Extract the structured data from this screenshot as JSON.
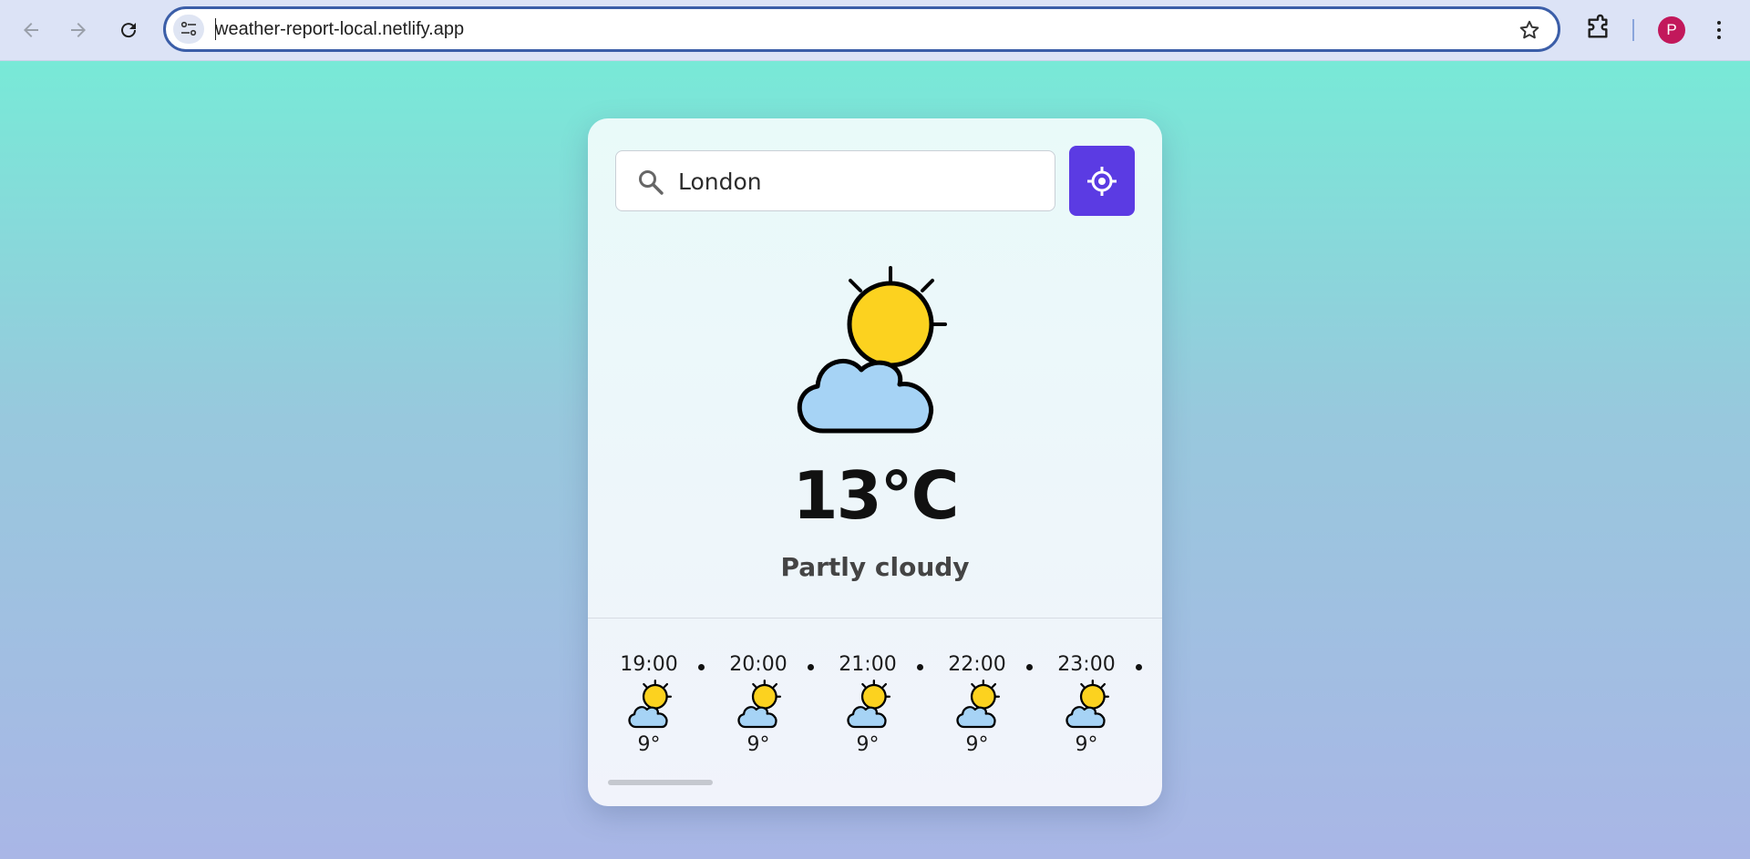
{
  "browser": {
    "url": "weather-report-local.netlify.app",
    "profile_initial": "P",
    "icons": {
      "back": "arrow-left-icon",
      "forward": "arrow-right-icon",
      "reload": "reload-icon",
      "site_info": "tune-icon",
      "bookmark": "star-icon",
      "extensions": "puzzle-icon",
      "menu": "three-dots-vertical-icon"
    },
    "profile_color": "#c2185b"
  },
  "search": {
    "value": "London",
    "icon": "search-icon"
  },
  "locate_button": {
    "icon": "crosshair-location-icon",
    "color": "#5b3be3"
  },
  "current": {
    "icon": "partly-cloudy-icon",
    "temperature": "13°C",
    "condition": "Partly cloudy"
  },
  "hourly": [
    {
      "time": "19:00",
      "icon": "partly-cloudy-icon",
      "temp": "9°"
    },
    {
      "time": "20:00",
      "icon": "partly-cloudy-icon",
      "temp": "9°"
    },
    {
      "time": "21:00",
      "icon": "partly-cloudy-icon",
      "temp": "9°"
    },
    {
      "time": "22:00",
      "icon": "partly-cloudy-icon",
      "temp": "9°"
    },
    {
      "time": "23:00",
      "icon": "partly-cloudy-icon",
      "temp": "9°"
    }
  ],
  "colors": {
    "page_gradient_top": "#78e9d7",
    "page_gradient_bottom": "#a9b6e6",
    "accent": "#5b3be3",
    "sun": "#fcd21f",
    "cloud": "#a6d3f5"
  }
}
